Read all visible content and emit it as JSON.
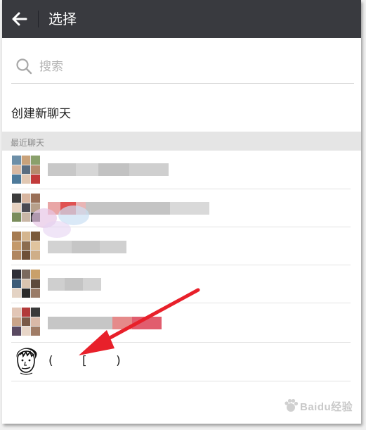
{
  "header": {
    "title": "选择",
    "back_icon": "arrow-left-icon"
  },
  "search": {
    "placeholder": "搜索",
    "value": ""
  },
  "new_chat": {
    "label": "创建新聊天"
  },
  "recent": {
    "section_label": "最近聊天",
    "items": [
      {
        "type": "group",
        "name_visible": false
      },
      {
        "type": "group",
        "name_visible": false
      },
      {
        "type": "group",
        "name_visible": false
      },
      {
        "type": "group",
        "name_visible": false
      },
      {
        "type": "group",
        "name_visible": false
      }
    ],
    "contact": {
      "name_text": "( [ )"
    }
  },
  "colors": {
    "titlebar_bg": "#393a3f",
    "title_text": "#ffffff",
    "section_bg": "#e5e5e5",
    "annotation_arrow": "#e8202a"
  },
  "watermark": {
    "text": "Baidu经验"
  }
}
